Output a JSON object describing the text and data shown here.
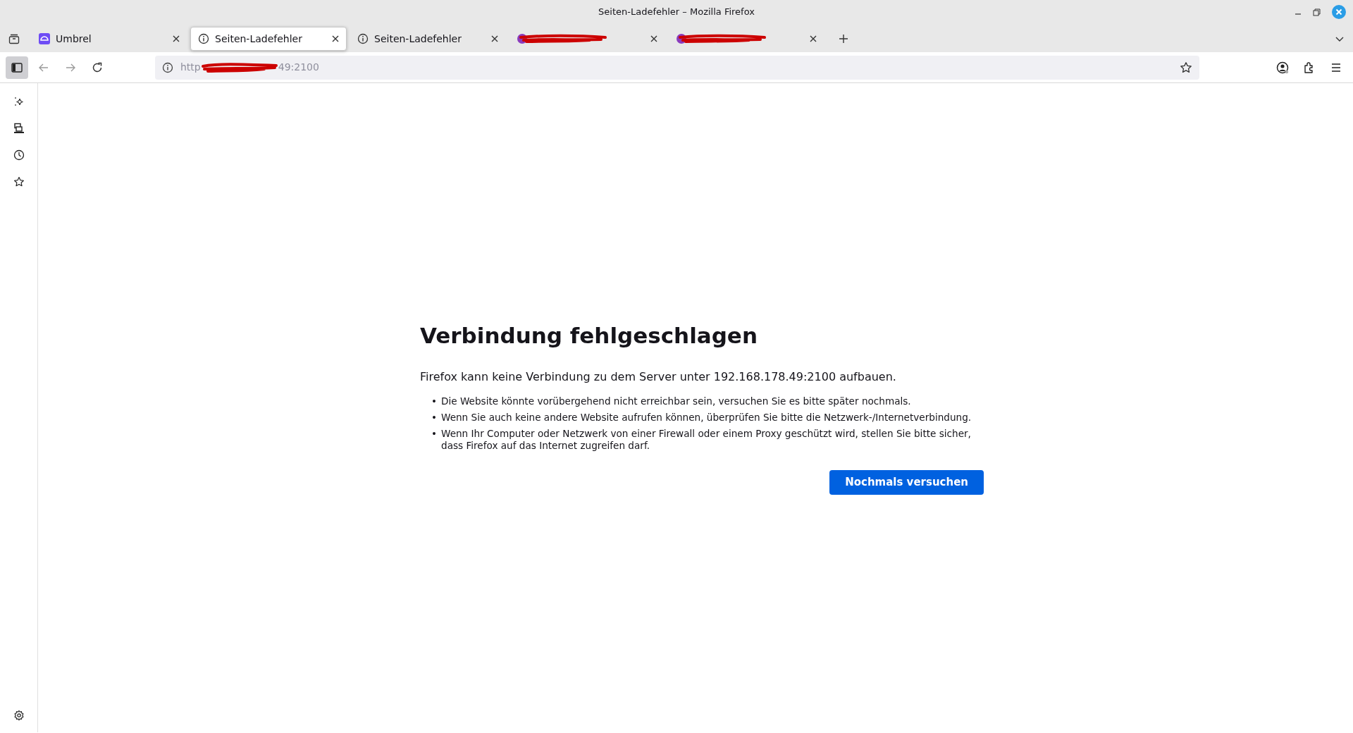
{
  "window": {
    "title": "Seiten-Ladefehler – Mozilla Firefox"
  },
  "tabs": [
    {
      "kind": "app",
      "label": "Umbrel",
      "selected": false
    },
    {
      "kind": "info",
      "label": "Seiten-Ladefehler",
      "selected": true
    },
    {
      "kind": "info",
      "label": "Seiten-Ladefehler",
      "selected": false
    },
    {
      "kind": "redacted",
      "selected": false
    },
    {
      "kind": "redacted",
      "selected": false
    }
  ],
  "address_bar": {
    "url_start": "http",
    "url_end": "49:2100"
  },
  "error_page": {
    "heading": "Verbindung fehlgeschlagen",
    "intro": "Firefox kann keine Verbindung zu dem Server unter 192.168.178.49:2100 aufbauen.",
    "tips": [
      {
        "bullet": "•",
        "text": "Die Website könnte vorübergehend nicht erreichbar sein, versuchen Sie es bitte später nochmals."
      },
      {
        "bullet": "•",
        "text": "Wenn Sie auch keine andere Website aufrufen können, überprüfen Sie bitte die Netzwerk-/Internetverbindung."
      },
      {
        "bullet": "•",
        "text": "Wenn Ihr Computer oder Netzwerk von einer Firewall oder einem Proxy geschützt wird, stellen Sie bitte sicher, dass Firefox auf das Internet zugreifen darf."
      }
    ],
    "button": "Nochmals versuchen"
  }
}
